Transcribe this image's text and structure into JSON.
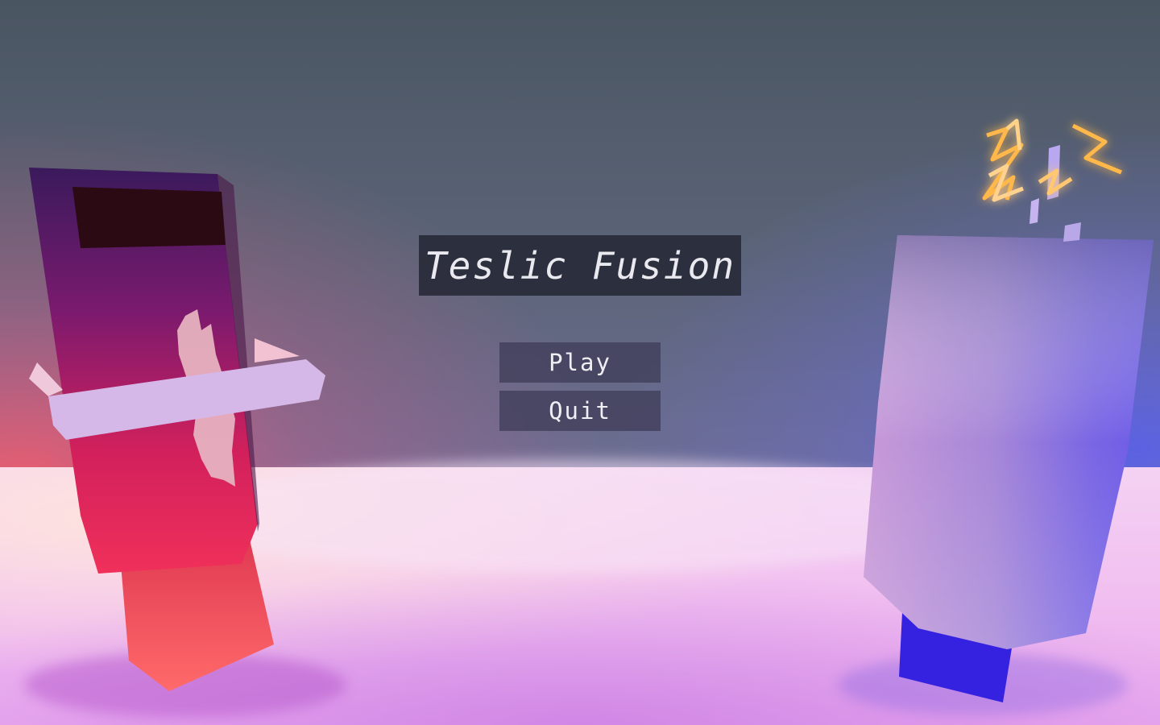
{
  "game": {
    "title": "Teslic Fusion"
  },
  "main_menu": {
    "buttons": [
      {
        "id": "play",
        "label": "Play"
      },
      {
        "id": "quit",
        "label": "Quit"
      }
    ]
  },
  "scene": {
    "characters": [
      {
        "id": "knight-character",
        "description_icon": "knight-helmet-icon",
        "accent_color": "#e0305f"
      },
      {
        "id": "tesla-coil-character",
        "description_icon": "lightning-icon",
        "accent_color": "#6a5ae6"
      }
    ],
    "colors": {
      "sky_top": "#4b5663",
      "sky_mid": "#6b6e93",
      "floor_light": "#f3c8f5",
      "glow_red": "#ff4a6a",
      "glow_blue": "#5a5cf0",
      "spark_orange": "#ffb050",
      "ui_panel": "#282a38",
      "ui_button": "#42405c",
      "ui_text": "#eeeef4"
    }
  }
}
